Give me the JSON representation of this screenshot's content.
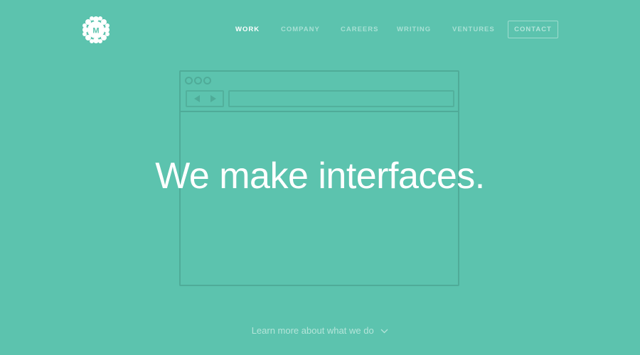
{
  "brand": {
    "logo_letter": "M",
    "logo_icon": "flower-badge-icon"
  },
  "nav": {
    "items": [
      {
        "label": "WORK",
        "active": true
      },
      {
        "label": "COMPANY",
        "active": false
      },
      {
        "label": "CAREERS",
        "active": false
      },
      {
        "label": "WRITING",
        "active": false
      },
      {
        "label": "VENTURES",
        "active": false
      }
    ],
    "contact_label": "CONTACT"
  },
  "hero": {
    "headline": "We make interfaces.",
    "illustration": "browser-window-icon"
  },
  "footer_link": {
    "label": "Learn more about what we do",
    "icon": "chevron-down-icon"
  },
  "colors": {
    "background": "#5cc3ae",
    "text": "#ffffff",
    "outline": "#4fab98"
  }
}
